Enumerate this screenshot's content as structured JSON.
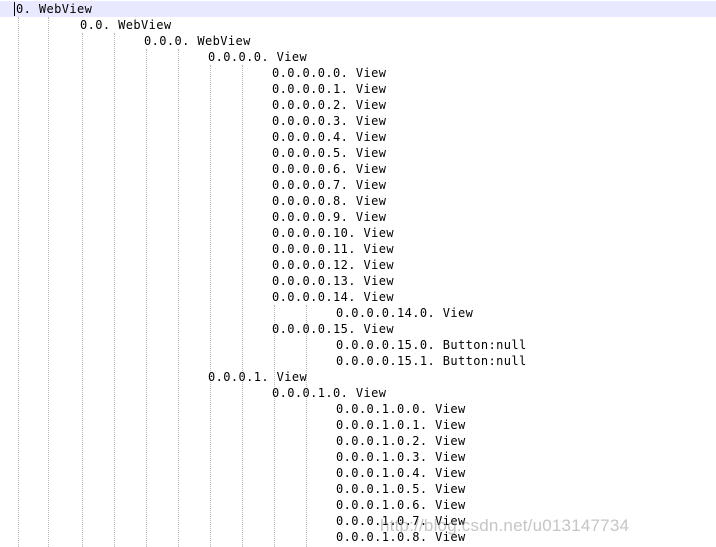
{
  "tree": {
    "lines": [
      {
        "text": "0. WebView",
        "level": 0
      },
      {
        "text": "0.0. WebView",
        "level": 1
      },
      {
        "text": "0.0.0. WebView",
        "level": 2
      },
      {
        "text": "0.0.0.0. View",
        "level": 3
      },
      {
        "text": "0.0.0.0.0. View",
        "level": 4
      },
      {
        "text": "0.0.0.0.1. View",
        "level": 4
      },
      {
        "text": "0.0.0.0.2. View",
        "level": 4
      },
      {
        "text": "0.0.0.0.3. View",
        "level": 4
      },
      {
        "text": "0.0.0.0.4. View",
        "level": 4
      },
      {
        "text": "0.0.0.0.5. View",
        "level": 4
      },
      {
        "text": "0.0.0.0.6. View",
        "level": 4
      },
      {
        "text": "0.0.0.0.7. View",
        "level": 4
      },
      {
        "text": "0.0.0.0.8. View",
        "level": 4
      },
      {
        "text": "0.0.0.0.9. View",
        "level": 4
      },
      {
        "text": "0.0.0.0.10. View",
        "level": 4
      },
      {
        "text": "0.0.0.0.11. View",
        "level": 4
      },
      {
        "text": "0.0.0.0.12. View",
        "level": 4
      },
      {
        "text": "0.0.0.0.13. View",
        "level": 4
      },
      {
        "text": "0.0.0.0.14. View",
        "level": 4
      },
      {
        "text": "0.0.0.0.14.0. View",
        "level": 5
      },
      {
        "text": "0.0.0.0.15. View",
        "level": 4
      },
      {
        "text": "0.0.0.0.15.0. Button:null",
        "level": 5
      },
      {
        "text": "0.0.0.0.15.1. Button:null",
        "level": 5
      },
      {
        "text": "0.0.0.1. View",
        "level": 3
      },
      {
        "text": "0.0.0.1.0. View",
        "level": 4
      },
      {
        "text": "0.0.0.1.0.0. View",
        "level": 5
      },
      {
        "text": "0.0.0.1.0.1. View",
        "level": 5
      },
      {
        "text": "0.0.0.1.0.2. View",
        "level": 5
      },
      {
        "text": "0.0.0.1.0.3. View",
        "level": 5
      },
      {
        "text": "0.0.0.1.0.4. View",
        "level": 5
      },
      {
        "text": "0.0.0.1.0.5. View",
        "level": 5
      },
      {
        "text": "0.0.0.1.0.6. View",
        "level": 5
      },
      {
        "text": "0.0.0.1.0.7. View",
        "level": 5
      },
      {
        "text": "0.0.0.1.0.8. View",
        "level": 5
      }
    ]
  },
  "watermark": "http://blog.csdn.net/u013147734",
  "colors": {
    "background": "#ffffff",
    "current_line": "#e8e8ff",
    "indent_guide": "#b8b8b8",
    "text": "#000000",
    "watermark": "#969696"
  }
}
